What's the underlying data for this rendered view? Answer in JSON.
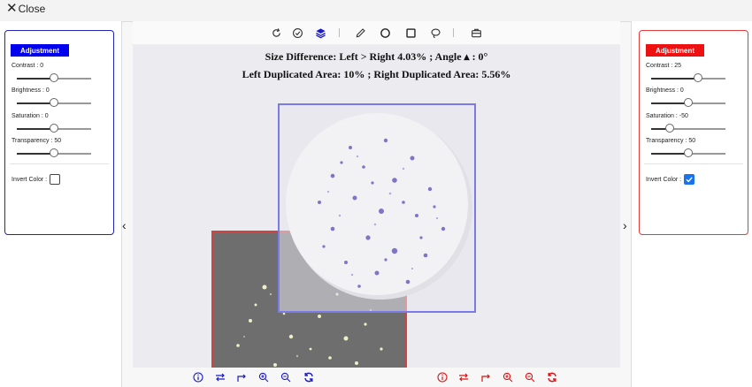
{
  "topbar": {
    "close_label": "Close"
  },
  "left_panel": {
    "title": "Adjustment",
    "sliders": [
      {
        "label": "Contrast : 0",
        "value": 0
      },
      {
        "label": "Brightness : 0",
        "value": 0
      },
      {
        "label": "Saturation : 0",
        "value": 0
      },
      {
        "label": "Transparency : 50",
        "value": 50
      }
    ],
    "invert_label": "Invert Color :",
    "invert_checked": false,
    "accent": "#0000ee"
  },
  "right_panel": {
    "title": "Adjustment",
    "sliders": [
      {
        "label": "Contrast : 25",
        "value": 25
      },
      {
        "label": "Brightness : 0",
        "value": 0
      },
      {
        "label": "Saturation : -50",
        "value": -50
      },
      {
        "label": "Transparency : 50",
        "value": 50
      }
    ],
    "invert_label": "Invert Color :",
    "invert_checked": true,
    "accent": "#ee1111"
  },
  "toolbar": {
    "icons": [
      "rotate-icon",
      "check-circle-icon",
      "layers-icon",
      "pencil-icon",
      "circle-icon",
      "square-icon",
      "lasso-icon",
      "toolbox-icon"
    ]
  },
  "info": {
    "line1": "Size Difference: Left  >  Right  4.03%  ;  Angle ▴ : 0°",
    "line2": "Left Duplicated Area: 10%  ;  Right Duplicated Area: 5.56%"
  },
  "bottom": {
    "left_color": "#1a1acc",
    "right_color": "#dd1111",
    "icons": [
      "info-icon",
      "swap-icon",
      "redo-icon",
      "zoom-in-icon",
      "zoom-out-icon",
      "refresh-icon"
    ]
  }
}
